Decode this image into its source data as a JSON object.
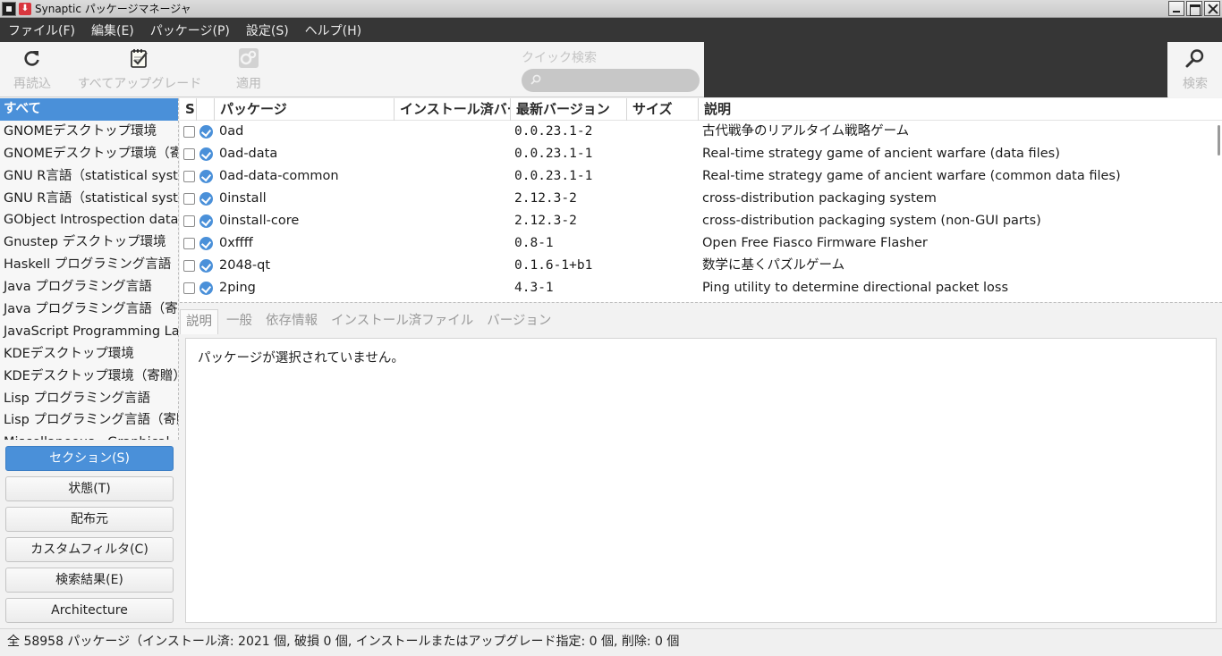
{
  "window": {
    "title": "Synaptic パッケージマネージャ"
  },
  "menubar": [
    "ファイル(F)",
    "編集(E)",
    "パッケージ(P)",
    "設定(S)",
    "ヘルプ(H)"
  ],
  "toolbar": {
    "reload_label": "再読込",
    "upgrade_all_label": "すべてアップグレード",
    "apply_label": "適用",
    "quick_search_label": "クイック検索",
    "quick_search_value": "",
    "search_label": "検索"
  },
  "categories": [
    "すべて",
    "GNOMEデスクトップ環境",
    "GNOMEデスクトップ環境（寄贈）",
    "GNU R言語（statistical system）",
    "GNU R言語（statistical system）",
    "GObject Introspection data",
    "Gnustep デスクトップ環境",
    "Haskell プログラミング言語",
    "Java プログラミング言語",
    "Java プログラミング言語（寄贈）",
    "JavaScript Programming Language",
    "KDEデスクトップ環境",
    "KDEデスクトップ環境（寄贈）",
    "Lisp プログラミング言語",
    "Lisp プログラミング言語（寄贈）",
    "Miscellaneous - Graphical"
  ],
  "filters": {
    "section": "セクション(S)",
    "status": "状態(T)",
    "origin": "配布元",
    "custom": "カスタムフィルタ(C)",
    "search_results": "検索結果(E)",
    "architecture": "Architecture"
  },
  "table": {
    "headers": {
      "s": "S",
      "package": "パッケージ",
      "installed": "インストール済バージョン",
      "latest": "最新バージョン",
      "size": "サイズ",
      "description": "説明"
    },
    "rows": [
      {
        "name": "0ad",
        "installed": "",
        "latest": "0.0.23.1-2",
        "size": "",
        "description": "古代戦争のリアルタイム戦略ゲーム"
      },
      {
        "name": "0ad-data",
        "installed": "",
        "latest": "0.0.23.1-1",
        "size": "",
        "description": "Real-time strategy game of ancient warfare (data files)"
      },
      {
        "name": "0ad-data-common",
        "installed": "",
        "latest": "0.0.23.1-1",
        "size": "",
        "description": "Real-time strategy game of ancient warfare (common data files)"
      },
      {
        "name": "0install",
        "installed": "",
        "latest": "2.12.3-2",
        "size": "",
        "description": "cross-distribution packaging system"
      },
      {
        "name": "0install-core",
        "installed": "",
        "latest": "2.12.3-2",
        "size": "",
        "description": "cross-distribution packaging system (non-GUI parts)"
      },
      {
        "name": "0xffff",
        "installed": "",
        "latest": "0.8-1",
        "size": "",
        "description": "Open Free Fiasco Firmware Flasher"
      },
      {
        "name": "2048-qt",
        "installed": "",
        "latest": "0.1.6-1+b1",
        "size": "",
        "description": "数学に基くパズルゲーム"
      },
      {
        "name": "2ping",
        "installed": "",
        "latest": "4.3-1",
        "size": "",
        "description": "Ping utility to determine directional packet loss"
      }
    ]
  },
  "details": {
    "tabs": [
      "説明",
      "一般",
      "依存情報",
      "インストール済ファイル",
      "バージョン"
    ],
    "message": "パッケージが選択されていません。"
  },
  "status": {
    "text": "全 58958 パッケージ（インストール済: 2021 個, 破損 0 個, インストールまたはアップグレード指定: 0 個, 削除: 0 個"
  },
  "colors": {
    "accent": "#4a90d9",
    "menubar_bg": "#363636"
  }
}
